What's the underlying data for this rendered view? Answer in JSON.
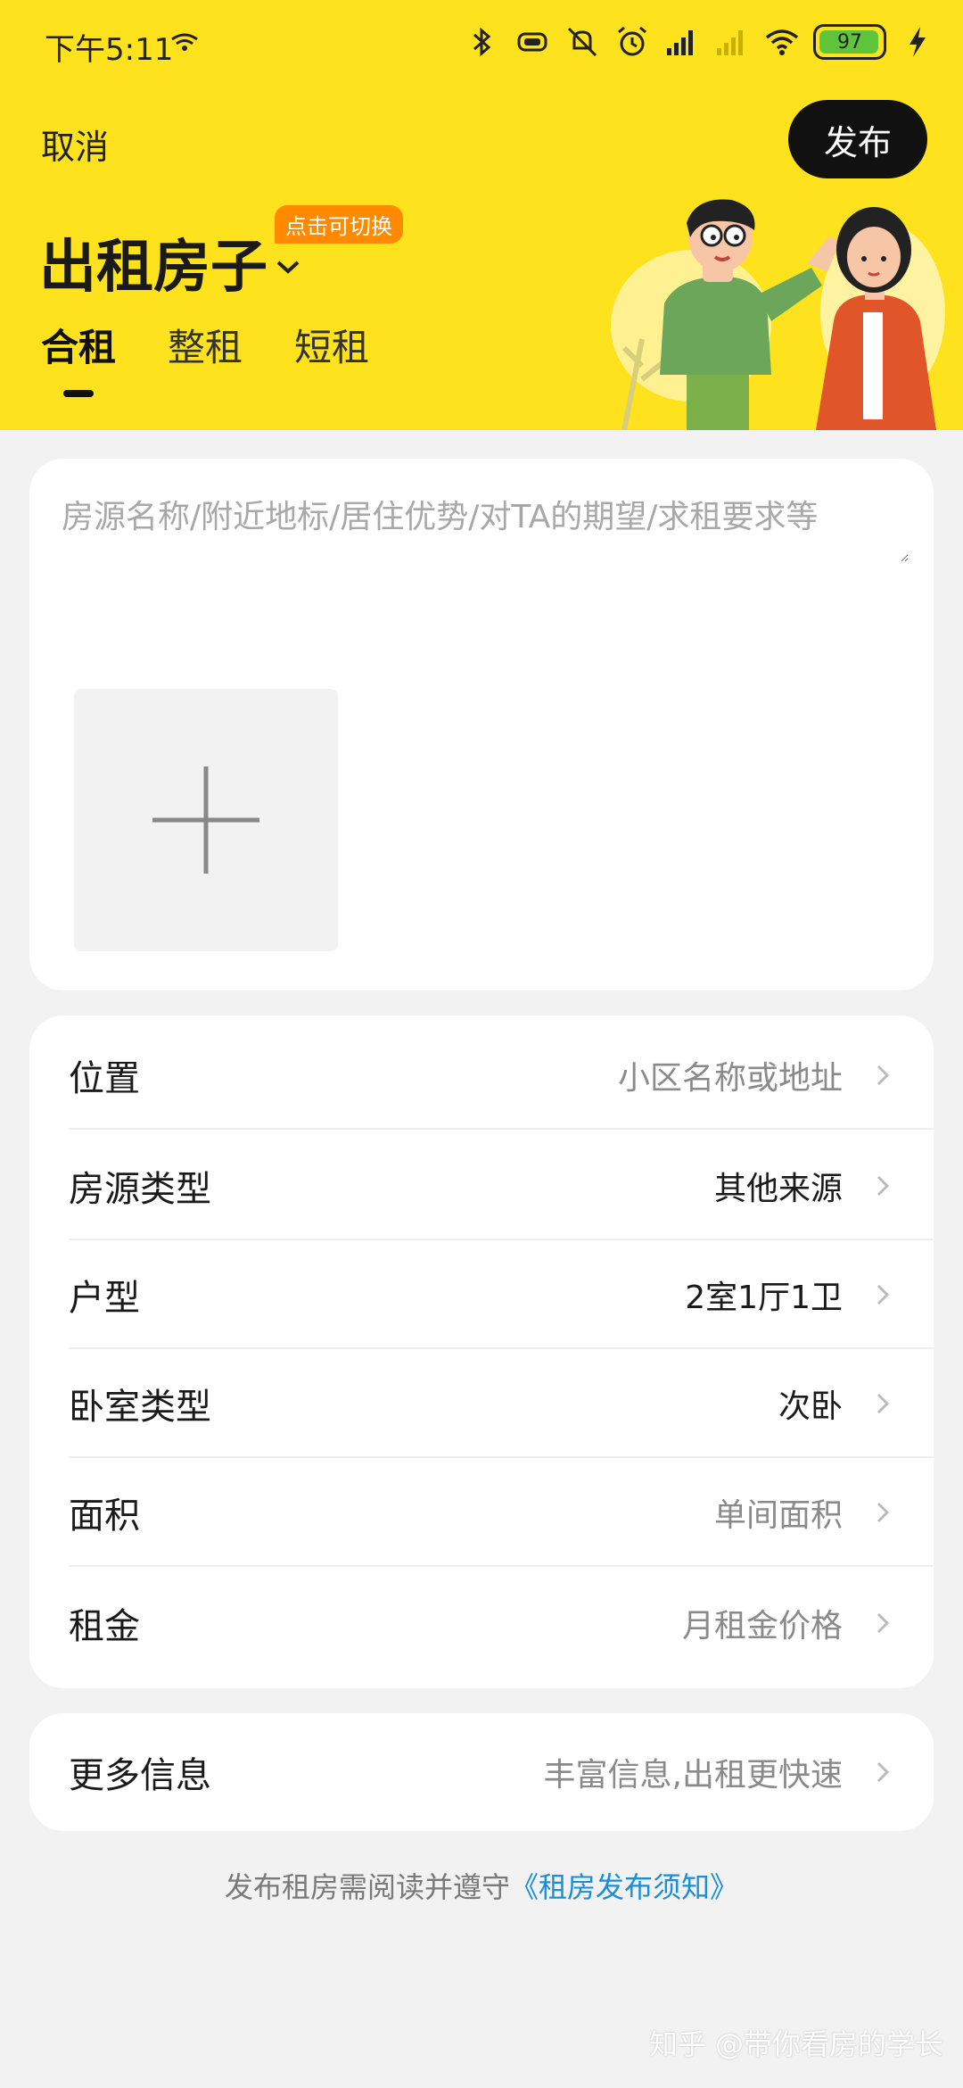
{
  "status_bar": {
    "time": "下午5:11",
    "battery": "97",
    "icons": [
      "bluetooth-icon",
      "vibrate-icon",
      "mute-icon",
      "alarm-icon",
      "signal-icon",
      "signal-weak-icon",
      "wifi-icon",
      "battery-icon",
      "charging-icon"
    ]
  },
  "header": {
    "cancel_label": "取消",
    "publish_label": "发布",
    "title": "出租房子",
    "switch_badge": "点击可切换",
    "tabs": [
      {
        "label": "合租",
        "active": true
      },
      {
        "label": "整租",
        "active": false
      },
      {
        "label": "短租",
        "active": false
      }
    ],
    "background_color": "#fee21d"
  },
  "description": {
    "placeholder": "房源名称/附近地标/居住优势/对TA的期望/求租要求等",
    "value": ""
  },
  "form": {
    "rows": [
      {
        "label": "位置",
        "value": "小区名称或地址",
        "is_placeholder": true
      },
      {
        "label": "房源类型",
        "value": "其他来源",
        "is_placeholder": false
      },
      {
        "label": "户型",
        "value": "2室1厅1卫",
        "is_placeholder": false
      },
      {
        "label": "卧室类型",
        "value": "次卧",
        "is_placeholder": false
      },
      {
        "label": "面积",
        "value": "单间面积",
        "is_placeholder": true
      },
      {
        "label": "租金",
        "value": "月租金价格",
        "is_placeholder": true
      }
    ]
  },
  "more_info": {
    "label": "更多信息",
    "value": "丰富信息,出租更快速"
  },
  "notice": {
    "text": "发布租房需阅读并遵守",
    "link": "《租房发布须知》",
    "link_color": "#1b8ed6"
  },
  "watermark": "知乎 @带你看房的学长"
}
